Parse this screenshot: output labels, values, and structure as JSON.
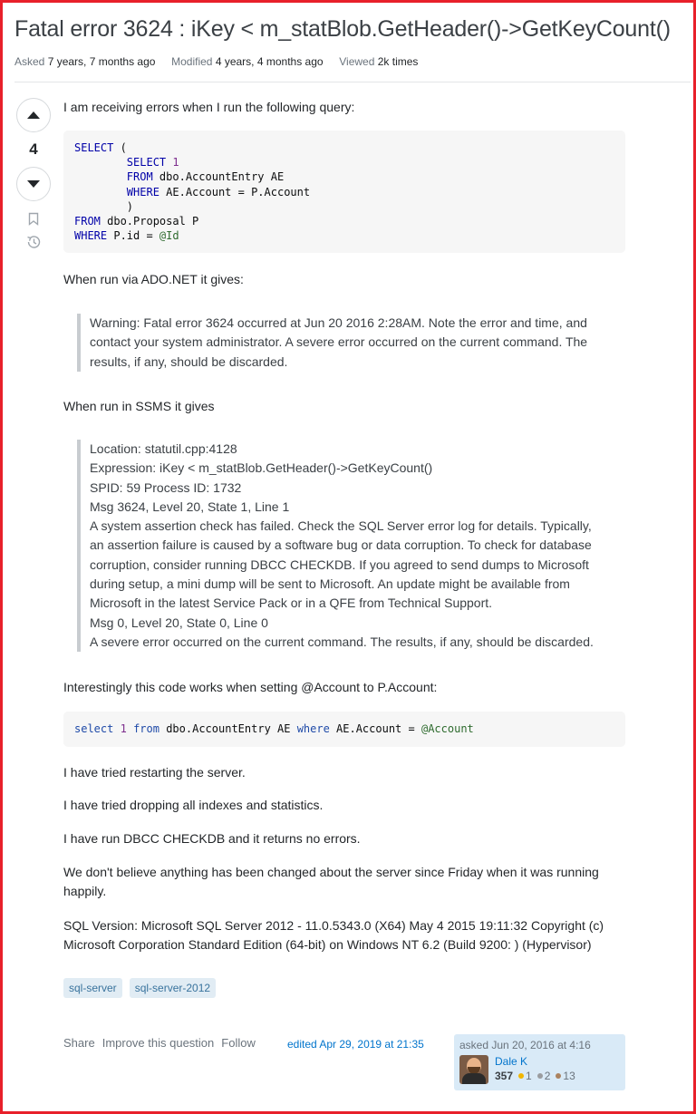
{
  "question": {
    "title": "Fatal error 3624 : iKey < m_statBlob.GetHeader()->GetKeyCount()",
    "asked_label": "Asked",
    "asked_value": "7 years, 7 months ago",
    "modified_label": "Modified",
    "modified_value": "4 years, 4 months ago",
    "viewed_label": "Viewed",
    "viewed_value": "2k times",
    "score": "4"
  },
  "body": {
    "intro": "I am receiving errors when I run the following query:",
    "code1_lines": [
      "SELECT (",
      "        SELECT 1",
      "        FROM dbo.AccountEntry AE",
      "        WHERE AE.Account = P.Account",
      "        )",
      "FROM dbo.Proposal P",
      "WHERE P.id = @Id"
    ],
    "ado_intro": "When run via ADO.NET it gives:",
    "ado_quote": "Warning: Fatal error 3624 occurred at Jun 20 2016 2:28AM. Note the error and time, and contact your system administrator. A severe error occurred on the current command. The results, if any, should be discarded.",
    "ssms_intro": "When run in SSMS it gives",
    "ssms_lines": [
      "Location: statutil.cpp:4128",
      "Expression: iKey < m_statBlob.GetHeader()->GetKeyCount()",
      "SPID: 59 Process ID: 1732",
      "Msg 3624, Level 20, State 1, Line 1",
      "A system assertion check has failed. Check the SQL Server error log for details. Typically,",
      "an assertion failure is caused by a software bug or data corruption. To check for database",
      "corruption, consider running DBCC CHECKDB. If you agreed to send dumps to Microsoft",
      "during setup, a mini dump will be sent to Microsoft. An update might be available from",
      "Microsoft in the latest Service Pack or in a QFE from Technical Support.",
      "Msg 0, Level 20, State 0, Line 0",
      "A severe error occurred on the current command. The results, if any, should be discarded."
    ],
    "interesting": "Interestingly this code works when setting @Account to P.Account:",
    "code2": "select 1 from dbo.AccountEntry AE where AE.Account = @Account",
    "p_restart": "I have tried restarting the server.",
    "p_dropping": "I have tried dropping all indexes and statistics.",
    "p_checkdb": "I have run DBCC CHECKDB and it returns no errors.",
    "p_friday_1": "We don't believe anything has been changed about the server since Friday when it was running",
    "p_friday_2": "happily.",
    "p_version_1": "SQL Version: Microsoft SQL Server 2012 - 11.0.5343.0 (X64) May 4 2015 19:11:32 Copyright (c)",
    "p_version_2": "Microsoft Corporation Standard Edition (64-bit) on Windows NT 6.2 (Build 9200: ) (Hypervisor)"
  },
  "tags": [
    "sql-server",
    "sql-server-2012"
  ],
  "actions": {
    "share": "Share",
    "improve": "Improve this question",
    "follow": "Follow"
  },
  "edited": "edited Apr 29, 2019 at 21:35",
  "owner": {
    "asked_text": "asked Jun 20, 2016 at 4:16",
    "name": "Dale K",
    "reputation": "357",
    "gold": "1",
    "silver": "2",
    "bronze": "13"
  },
  "colors": {
    "frame": "#e8202a",
    "link": "#0074cc",
    "tag_bg": "#e1ecf4",
    "owner_bg": "#d9eaf7"
  }
}
